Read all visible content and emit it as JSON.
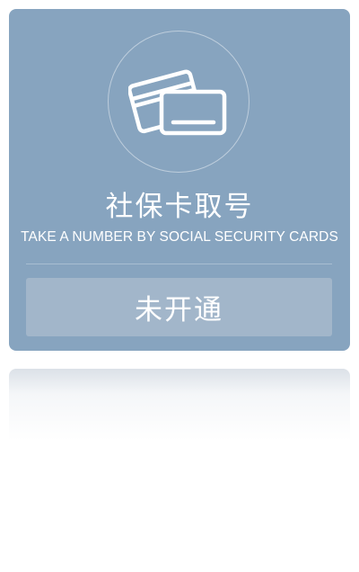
{
  "card": {
    "title": "社保卡取号",
    "subtitle": "TAKE A NUMBER BY SOCIAL SECURITY CARDS",
    "icon": "credit-cards-icon",
    "status_label": "未开通"
  },
  "colors": {
    "card_background": "#87a4bf",
    "button_background": "#a2b6ca",
    "text": "#ffffff"
  }
}
